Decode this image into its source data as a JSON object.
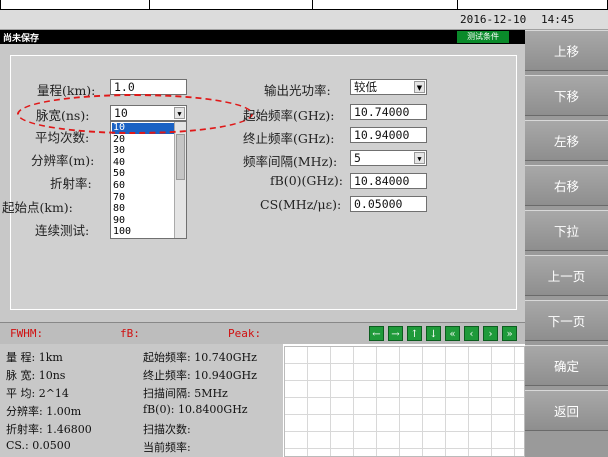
{
  "status": {
    "date": "2016-12-10",
    "time": "14:45",
    "unsaved": "尚未保存",
    "condition_badge": "测试条件"
  },
  "form_left": {
    "range_label": "量程(km):",
    "range_value": "1.0",
    "pulse_label": "脉宽(ns):",
    "pulse_value": "10",
    "avg_label": "平均次数:",
    "res_label": "分辨率(m):",
    "refr_label": "折射率:",
    "start_label": "起始点(km):",
    "cont_label": "连续测试:"
  },
  "dropdown": {
    "options": [
      "10",
      "20",
      "30",
      "40",
      "50",
      "60",
      "70",
      "80",
      "90",
      "100"
    ],
    "selected_index": 0
  },
  "form_right": {
    "power_label": "输出光功率:",
    "power_value": "较低",
    "start_freq_label": "起始频率(GHz):",
    "start_freq_value": "10.74000",
    "end_freq_label": "终止频率(GHz):",
    "end_freq_value": "10.94000",
    "step_label": "频率间隔(MHz):",
    "step_value": "5",
    "fb0_label": "fB(0)(GHz):",
    "fb0_value": "10.84000",
    "cs_label": "CS(MHz/με):",
    "cs_value": "0.05000"
  },
  "peak_bar": {
    "fwhm_label": "FWHM:",
    "fb_label": "fB:",
    "peak_label": "Peak:",
    "nav": [
      "←",
      "→",
      "↑",
      "↓",
      "«",
      "‹",
      "›",
      "»"
    ]
  },
  "info": {
    "l1a": "量  程: 1km",
    "l1b": "起始频率: 10.740GHz",
    "l2a": "脉  宽: 10ns",
    "l2b": "终止频率: 10.940GHz",
    "l3a": "平  均: 2^14",
    "l3b": "扫描间隔:  5MHz",
    "l4a": "分辨率: 1.00m",
    "l4b": "fB(0): 10.8400GHz",
    "l5a": "折射率: 1.46800",
    "l5b": "扫描次数:",
    "l6a": "CS.: 0.0500",
    "l6b": "当前频率:"
  },
  "sidebar": {
    "up": "上移",
    "down": "下移",
    "left": "左移",
    "right": "右移",
    "pulldown": "下拉",
    "prev_page": "上一页",
    "next_page": "下一页",
    "confirm": "确定",
    "back": "返回"
  }
}
